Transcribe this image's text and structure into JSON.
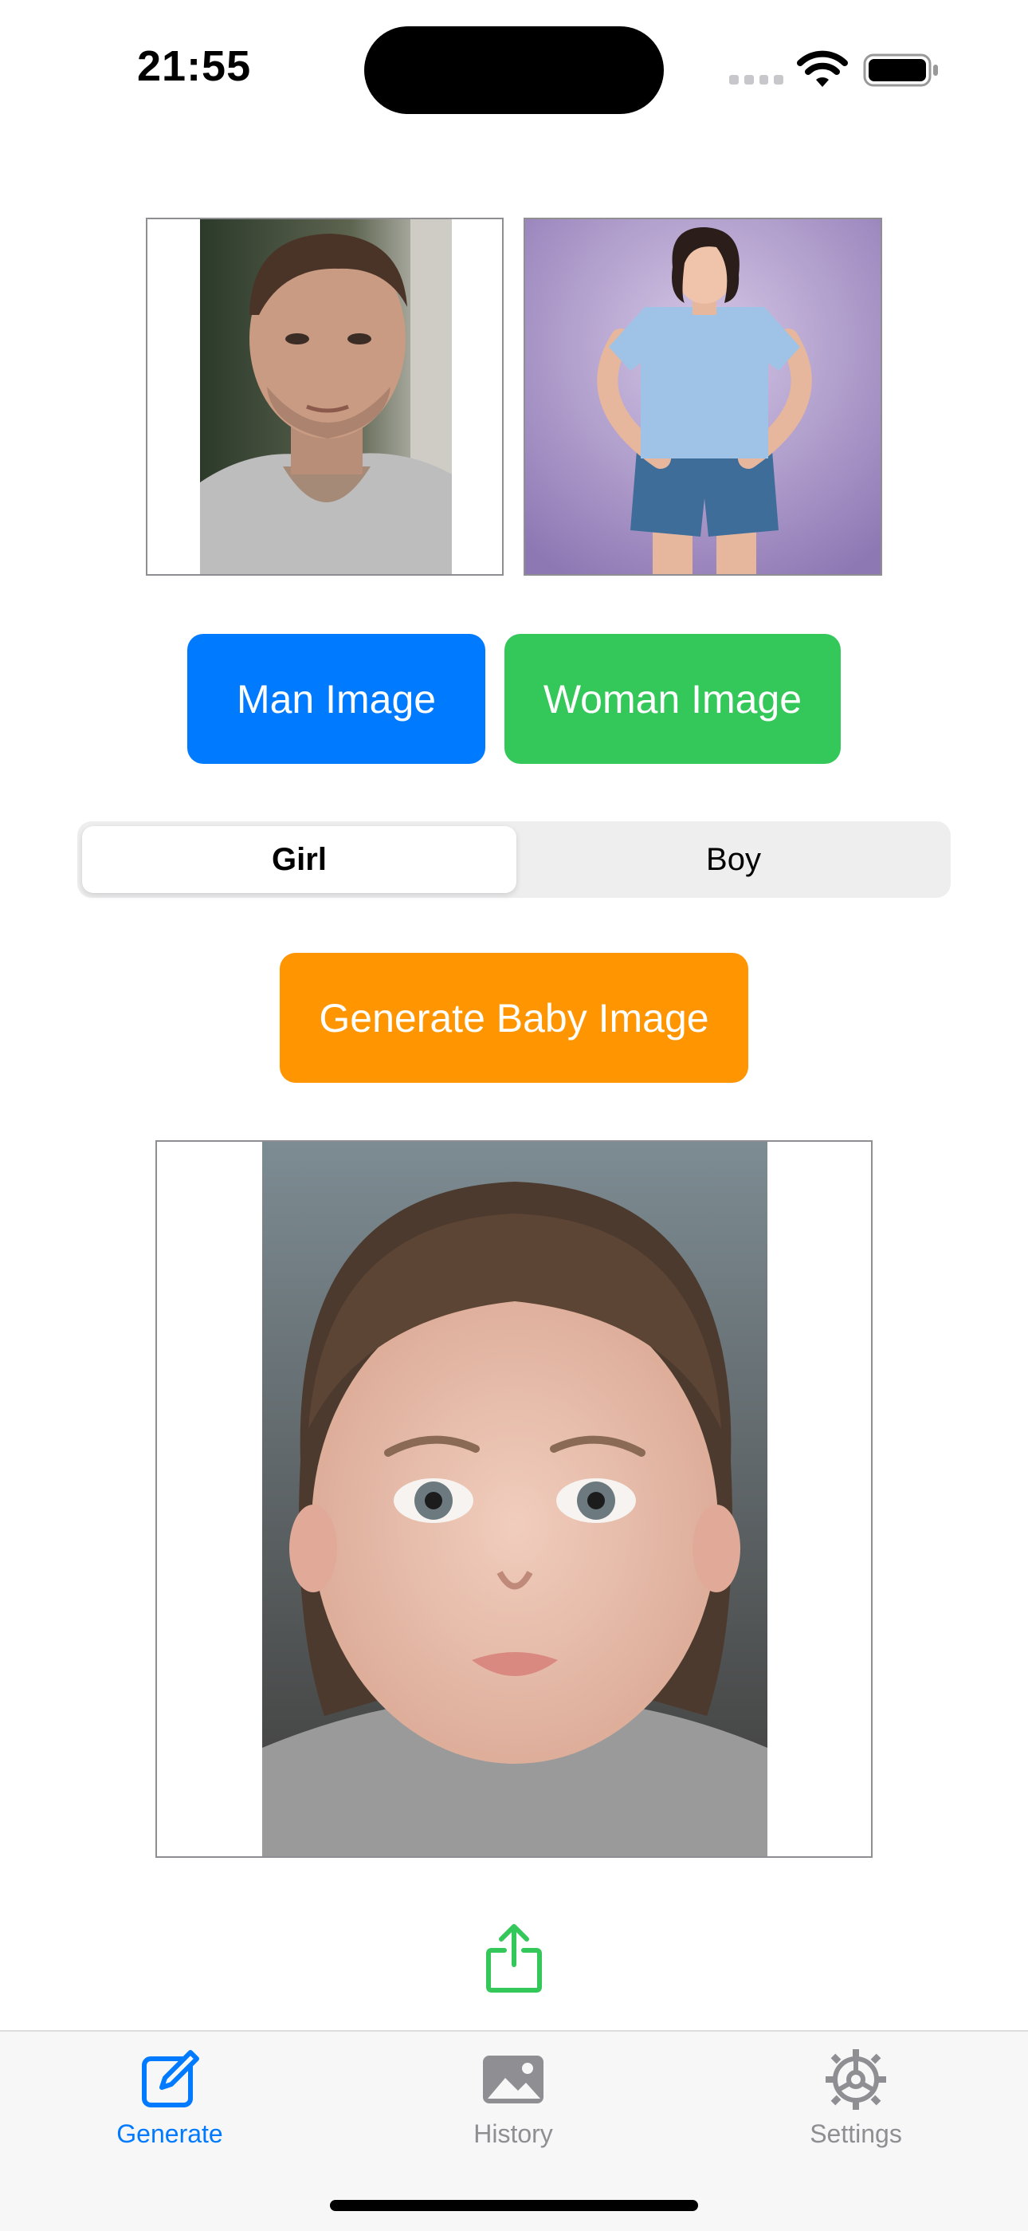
{
  "status_bar": {
    "time": "21:55",
    "icons": [
      "signal-icon",
      "wifi-icon",
      "battery-icon"
    ]
  },
  "parents": {
    "man_photo": "man-portrait-photo",
    "woman_photo": "woman-portrait-photo"
  },
  "buttons": {
    "man_label": "Man Image",
    "woman_label": "Woman Image",
    "generate_label": "Generate Baby Image"
  },
  "gender_selector": {
    "options": [
      "Girl",
      "Boy"
    ],
    "selected": "Girl"
  },
  "result": {
    "photo": "baby-girl-portrait-photo",
    "share_icon": "share-icon"
  },
  "tab_bar": {
    "items": [
      {
        "label": "Generate",
        "icon": "compose-icon",
        "active": true
      },
      {
        "label": "History",
        "icon": "photo-icon",
        "active": false
      },
      {
        "label": "Settings",
        "icon": "gear-icon",
        "active": false
      }
    ]
  },
  "colors": {
    "man_button": "#007aff",
    "woman_button": "#34c759",
    "generate_button": "#ff9500",
    "share_icon": "#34c759",
    "active_tab": "#007aff",
    "inactive_tab": "#8e8e93"
  }
}
